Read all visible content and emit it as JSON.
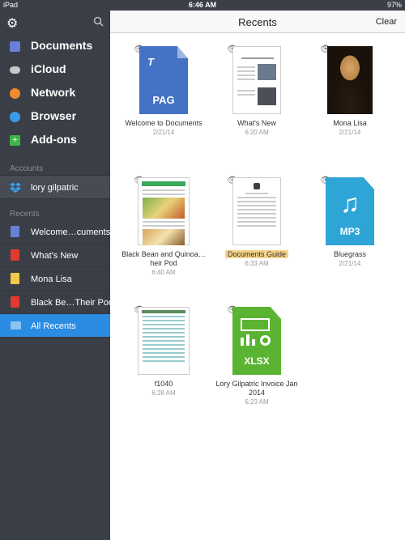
{
  "status_bar": {
    "device": "iPad",
    "time": "6:46 AM",
    "battery": "97%"
  },
  "sidebar": {
    "nav": [
      {
        "label": "Documents",
        "icon": "documents-icon",
        "color": "#6a7fd6"
      },
      {
        "label": "iCloud",
        "icon": "cloud-icon",
        "color": "#c9c9c9"
      },
      {
        "label": "Network",
        "icon": "wifi-icon",
        "color": "#f08a2c"
      },
      {
        "label": "Browser",
        "icon": "compass-icon",
        "color": "#3a9be8"
      },
      {
        "label": "Add-ons",
        "icon": "plus-icon",
        "color": "#3fb44a"
      }
    ],
    "accounts_header": "Accounts",
    "account": {
      "label": "lory gilpatric",
      "icon": "dropbox-icon"
    },
    "recents_header": "Recents",
    "recents": [
      {
        "label": "Welcome…cuments",
        "icon": "pag-file-icon",
        "color": "#6a7fd6"
      },
      {
        "label": "What's New",
        "icon": "pdf-icon",
        "color": "#e03a2f"
      },
      {
        "label": "Mona Lisa",
        "icon": "image-file-icon",
        "color": "#f2c94c"
      },
      {
        "label": "Black Be…Their Pod",
        "icon": "pdf-icon",
        "color": "#e03a2f"
      },
      {
        "label": "All Recents",
        "icon": "folder-icon",
        "color": "#8bc3f0",
        "active": true
      }
    ]
  },
  "main": {
    "title": "Recents",
    "clear_label": "Clear",
    "files": [
      {
        "name": "Welcome to Documents",
        "date": "2/21/14",
        "kind": "pag",
        "ext": "PAG",
        "letter": "T"
      },
      {
        "name": "What's New",
        "date": "6:20 AM",
        "kind": "doc"
      },
      {
        "name": "Mona Lisa",
        "date": "2/21/14",
        "kind": "image"
      },
      {
        "name": "Black Bean and Quinoa…heir Pod",
        "date": "6:40 AM",
        "kind": "doc"
      },
      {
        "name": "Documents Guide",
        "date": "6:33 AM",
        "kind": "doc",
        "highlighted": true
      },
      {
        "name": "Bluegrass",
        "date": "2/21/14",
        "kind": "mp3",
        "ext": "MP3"
      },
      {
        "name": "f1040",
        "date": "6:28 AM",
        "kind": "doc"
      },
      {
        "name": "Lory Gilpatric Invoice Jan 2014",
        "date": "6:23 AM",
        "kind": "xlsx",
        "ext": "XLSX"
      }
    ]
  }
}
